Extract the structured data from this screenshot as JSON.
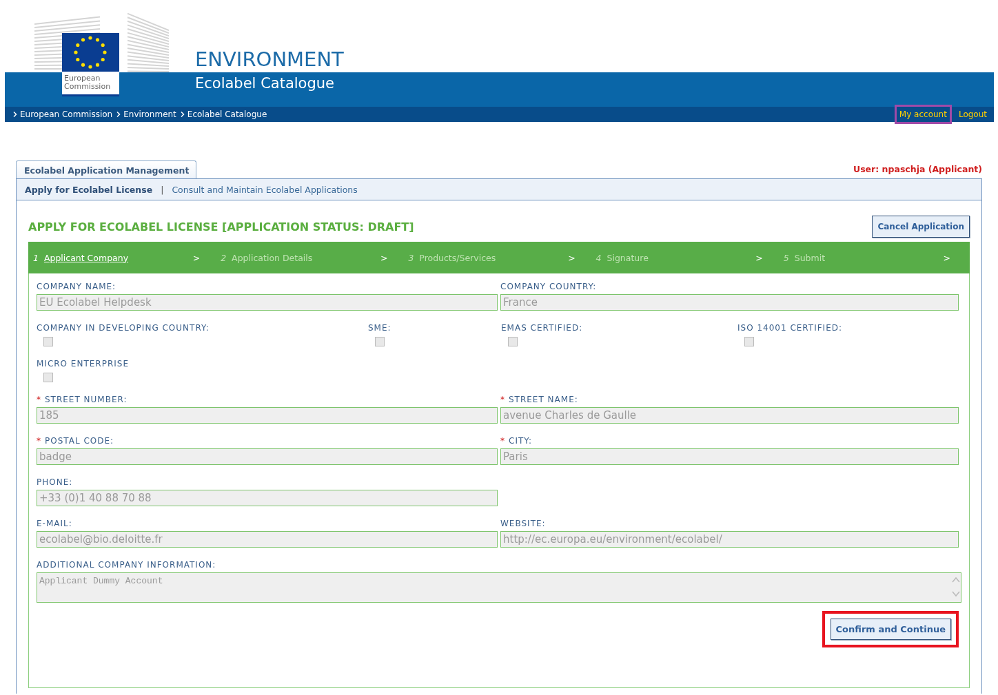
{
  "header": {
    "logo_text": "European Commission",
    "title": "ENVIRONMENT",
    "subtitle": "Ecolabel Catalogue",
    "breadcrumb": [
      "European Commission",
      "Environment",
      "Ecolabel Catalogue"
    ],
    "links": [
      {
        "label": "My account",
        "highlighted": true
      },
      {
        "label": "Logout",
        "highlighted": false
      }
    ]
  },
  "panel": {
    "tab": "Ecolabel Application Management",
    "user": "User: npaschja (Applicant)",
    "subnav": [
      {
        "label": "Apply for Ecolabel License",
        "selected": true
      },
      {
        "label": "Consult and Maintain Ecolabel Applications",
        "selected": false
      }
    ],
    "subnav_separator": "|",
    "title": "APPLY FOR ECOLABEL LICENSE [APPLICATION STATUS: DRAFT]",
    "cancel_button": "Cancel Application",
    "steps": [
      {
        "number": "1",
        "label": "Applicant Company",
        "arrow": ">",
        "selected": true
      },
      {
        "number": "2",
        "label": "Application Details",
        "arrow": ">",
        "selected": false
      },
      {
        "number": "3",
        "label": "Products/Services",
        "arrow": ">",
        "selected": false
      },
      {
        "number": "4",
        "label": "Signature",
        "arrow": ">",
        "selected": false
      },
      {
        "number": "5",
        "label": "Submit",
        "arrow": ">",
        "selected": false
      }
    ],
    "rows": [
      {
        "kind": "halves",
        "fields": [
          {
            "kind": "text",
            "label": "COMPANY NAME:",
            "value": "EU Ecolabel Helpdesk"
          },
          {
            "kind": "text",
            "label": "COMPANY COUNTRY:",
            "value": "France"
          }
        ]
      },
      {
        "kind": "quarters",
        "fields": [
          {
            "kind": "checkbox",
            "label": "COMPANY IN DEVELOPING COUNTRY:",
            "checked": false
          },
          {
            "kind": "checkbox",
            "label": "SME:",
            "checked": false
          },
          {
            "kind": "checkbox",
            "label": "EMAS CERTIFIED:",
            "checked": false
          },
          {
            "kind": "checkbox",
            "label": "ISO 14001 CERTIFIED:",
            "checked": false
          }
        ]
      },
      {
        "kind": "quarters",
        "fields": [
          {
            "kind": "checkbox",
            "label": "MICRO ENTERPRISE",
            "checked": false
          }
        ]
      },
      {
        "kind": "halves",
        "fields": [
          {
            "kind": "text",
            "required_mark": "*",
            "label": "STREET NUMBER:",
            "value": "185"
          },
          {
            "kind": "text",
            "required_mark": "*",
            "label": "STREET NAME:",
            "value": "avenue Charles de Gaulle"
          }
        ]
      },
      {
        "kind": "halves",
        "fields": [
          {
            "kind": "text",
            "required_mark": "*",
            "label": "POSTAL CODE:",
            "value": "badge"
          },
          {
            "kind": "text",
            "required_mark": "*",
            "label": "CITY:",
            "value": "Paris"
          }
        ]
      },
      {
        "kind": "halves",
        "fields": [
          {
            "kind": "text",
            "label": "PHONE:",
            "value": "+33 (0)1 40 88 70 88"
          }
        ]
      },
      {
        "kind": "halves",
        "fields": [
          {
            "kind": "text",
            "label": "E-MAIL:",
            "value": "ecolabel@bio.deloitte.fr"
          },
          {
            "kind": "text",
            "label": "WEBSITE:",
            "value": "http://ec.europa.eu/environment/ecolabel/"
          }
        ]
      },
      {
        "kind": "full",
        "fields": [
          {
            "kind": "textarea",
            "label": "ADDITIONAL COMPANY INFORMATION:",
            "value": "Applicant Dummy Account"
          }
        ]
      }
    ],
    "confirm_button": {
      "label": "Confirm and Continue",
      "highlighted": true
    }
  }
}
